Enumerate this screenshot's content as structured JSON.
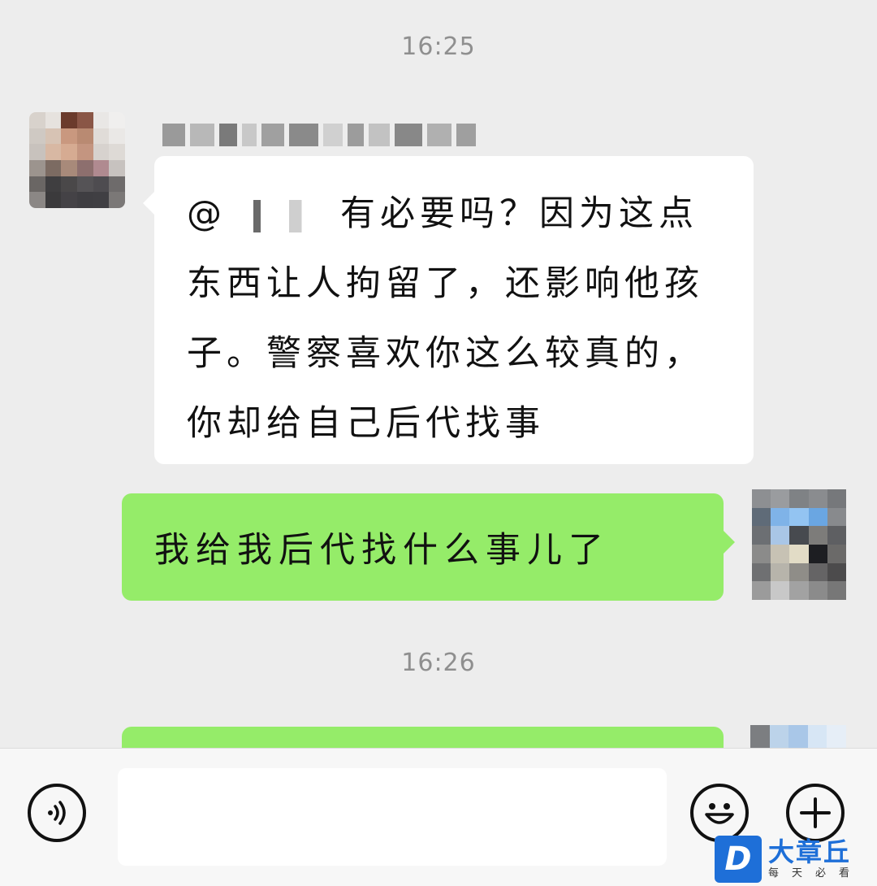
{
  "chat": {
    "timestamps": [
      "16:25",
      "16:26"
    ],
    "messages": [
      {
        "side": "left",
        "text": "有必要吗？因为这点东西让人拘留了，还影响他孩子。警察喜欢你这么较真的，你却给自己后代找事"
      },
      {
        "side": "right",
        "text": "我给我后代找什么事儿了"
      }
    ]
  },
  "input_bar": {
    "voice_icon": "voice-icon",
    "emoji_icon": "emoji-icon",
    "plus_icon": "plus-icon"
  },
  "watermark": {
    "logo": "D",
    "title": "大章丘",
    "subtitle": "每天必看"
  },
  "colors": {
    "background": "#ededed",
    "incoming_bubble": "#ffffff",
    "outgoing_bubble": "#95ec69",
    "watermark_blue": "#1e6fd8"
  }
}
